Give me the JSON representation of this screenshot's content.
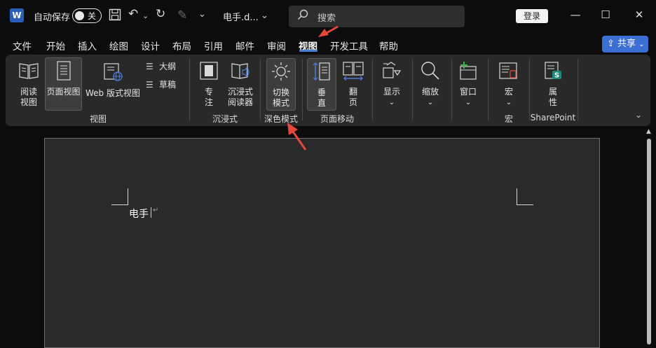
{
  "titlebar": {
    "logo_letter": "W",
    "autosave_label": "自动保存",
    "autosave_state": "关",
    "filename": "电手.d...",
    "search_placeholder": "搜索",
    "login_label": "登录",
    "minimize": "—",
    "maximize": "☐",
    "close": "✕"
  },
  "menu": {
    "tabs": [
      "文件",
      "开始",
      "插入",
      "绘图",
      "设计",
      "布局",
      "引用",
      "邮件",
      "审阅",
      "视图",
      "开发工具",
      "帮助"
    ],
    "active_tab": "视图",
    "share_label": "共享"
  },
  "ribbon": {
    "views": {
      "read_mode": "阅读\n视图",
      "print_layout": "页面视图",
      "web_layout": "Web 版式视图",
      "outline": "大纲",
      "draft": "草稿",
      "group_label": "视图"
    },
    "immersive": {
      "focus": "专\n注",
      "immersive_reader": "沉浸式\n阅读器",
      "group_label": "沉浸式"
    },
    "dark_mode": {
      "switch_mode": "切换\n模式",
      "group_label": "深色模式"
    },
    "page_movement": {
      "vertical": "垂\n直",
      "side_to_side": "翻\n页",
      "group_label": "页面移动"
    },
    "show": "显示",
    "zoom": "缩放",
    "window": "窗口",
    "macros": {
      "label": "宏",
      "group_label": "宏"
    },
    "sharepoint": {
      "label": "属\n性",
      "group_label": "SharePoint"
    }
  },
  "document": {
    "text": "电手",
    "paragraph_mark": "↵"
  },
  "colors": {
    "accent": "#4a7dd6",
    "share": "#3c6fd3",
    "annotation_arrow": "#e5473d",
    "ribbon_bg": "#292929",
    "doc_bg": "#2a2a2a"
  }
}
